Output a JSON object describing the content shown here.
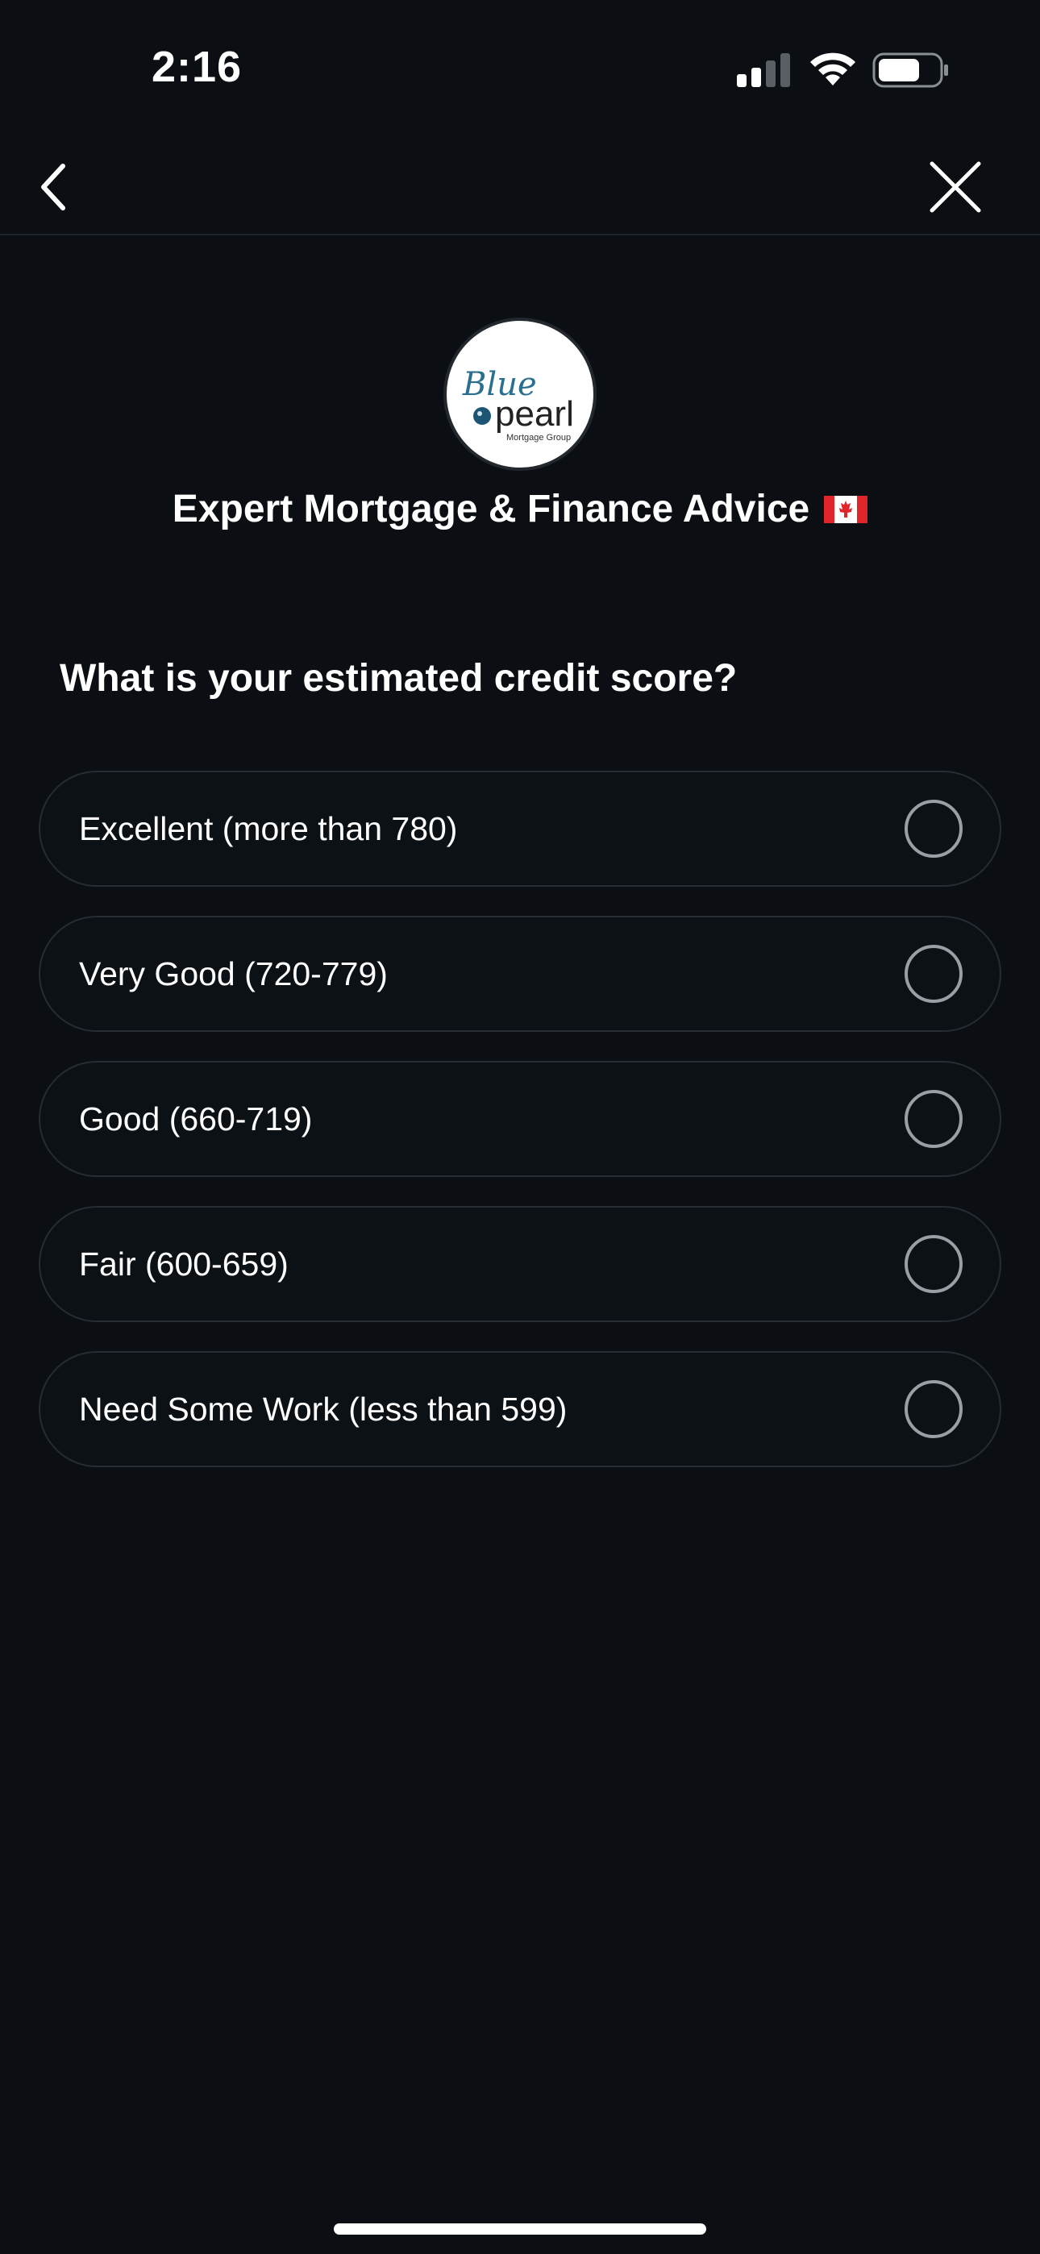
{
  "status_bar": {
    "time": "2:16",
    "signal_icon": "cellular-signal-icon",
    "wifi_icon": "wifi-icon",
    "battery_icon": "battery-icon"
  },
  "nav": {
    "back_icon": "chevron-left-icon",
    "close_icon": "close-icon"
  },
  "header": {
    "logo_text_script": "Blue",
    "logo_text_main": "pearl",
    "logo_subtext": "Mortgage Group",
    "title": "Expert Mortgage & Finance Advice",
    "flag_icon": "canada-flag-icon"
  },
  "question": "What is your estimated credit score?",
  "options": [
    {
      "label": "Excellent (more than 780)",
      "selected": false
    },
    {
      "label": "Very Good (720-779)",
      "selected": false
    },
    {
      "label": "Good (660-719)",
      "selected": false
    },
    {
      "label": "Fair (600-659)",
      "selected": false
    },
    {
      "label": "Need Some Work (less than 599)",
      "selected": false
    }
  ],
  "colors": {
    "background": "#0b0f13",
    "option_border": "#262c33",
    "radio_border": "#9a9fa5",
    "logo_blue": "#2a6f8f"
  }
}
